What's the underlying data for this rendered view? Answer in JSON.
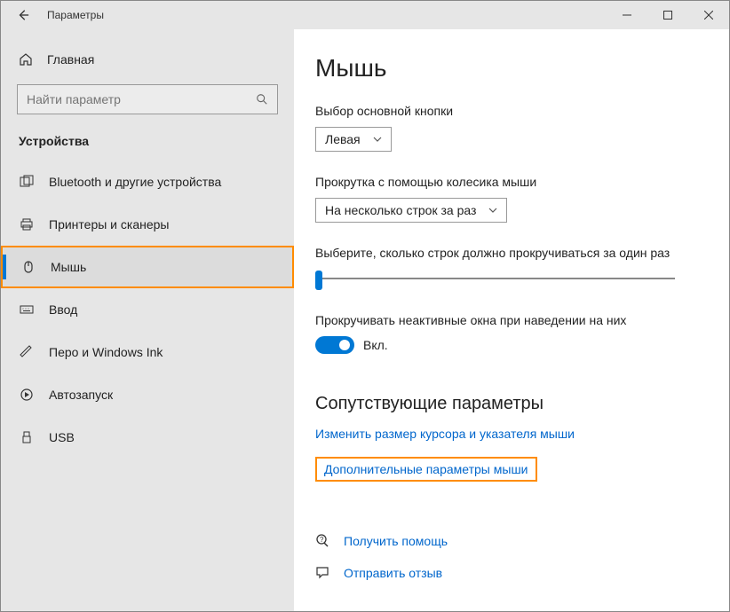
{
  "window": {
    "title": "Параметры"
  },
  "sidebar": {
    "home": "Главная",
    "search_placeholder": "Найти параметр",
    "category": "Устройства",
    "items": [
      {
        "label": "Bluetooth и другие устройства",
        "icon": "bluetooth"
      },
      {
        "label": "Принтеры и сканеры",
        "icon": "printer"
      },
      {
        "label": "Мышь",
        "icon": "mouse",
        "active": true
      },
      {
        "label": "Ввод",
        "icon": "keyboard"
      },
      {
        "label": "Перо и Windows Ink",
        "icon": "pen"
      },
      {
        "label": "Автозапуск",
        "icon": "autoplay"
      },
      {
        "label": "USB",
        "icon": "usb"
      }
    ]
  },
  "content": {
    "title": "Мышь",
    "primary_button_label": "Выбор основной кнопки",
    "primary_button_value": "Левая",
    "scroll_wheel_label": "Прокрутка с помощью колесика мыши",
    "scroll_wheel_value": "На несколько строк за раз",
    "lines_label": "Выберите, сколько строк должно прокручиваться за один раз",
    "inactive_label": "Прокручивать неактивные окна при наведении на них",
    "toggle_state": "Вкл.",
    "related_title": "Сопутствующие параметры",
    "link_cursor": "Изменить размер курсора и указателя мыши",
    "link_advanced": "Дополнительные параметры мыши",
    "link_help": "Получить помощь",
    "link_feedback": "Отправить отзыв"
  }
}
